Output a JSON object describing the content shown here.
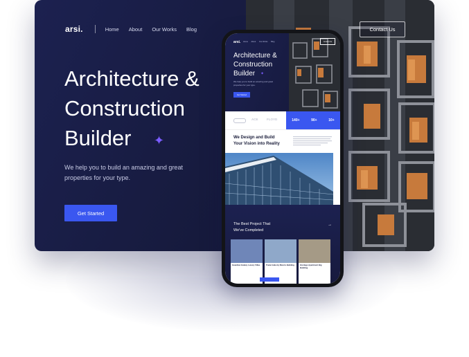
{
  "desktop": {
    "logo": "arsi.",
    "nav": [
      "Home",
      "About",
      "Our Works",
      "Blog"
    ],
    "contact_label": "Contact Us",
    "hero_title_lines": [
      "Architecture &",
      "Construction",
      "Builder"
    ],
    "sparkle_icon": "sparkle-icon",
    "hero_sub": "We help you to build an amazing and great properties for your type.",
    "cta_label": "Get Started"
  },
  "phone": {
    "title_lines": [
      "Architecture &",
      "Construction",
      "Builder"
    ],
    "logos": [
      "",
      "ACE",
      "FLOYD"
    ],
    "stats": [
      {
        "num": "140+",
        "label": ""
      },
      {
        "num": "90+",
        "label": ""
      },
      {
        "num": "10+",
        "label": ""
      }
    ],
    "design_lines": [
      "We Design and Build",
      "Your Vision into Reality"
    ],
    "projects_title_lines": [
      "The Best Project That",
      "We've Completed"
    ],
    "arrow_icon": "arrow-right-icon",
    "cards": [
      {
        "title": "Guardian Galaxy Luxury Villas",
        "color": "#6f86b8"
      },
      {
        "title": "Trade Industry Marvis Building",
        "color": "#8fa8c9"
      },
      {
        "title": "Giorlago Apartment Big Building",
        "color": "#a59a86"
      }
    ]
  },
  "colors": {
    "accent": "#3a57f0",
    "sparkle": "#7b5cff",
    "navy": "#1c2150"
  }
}
